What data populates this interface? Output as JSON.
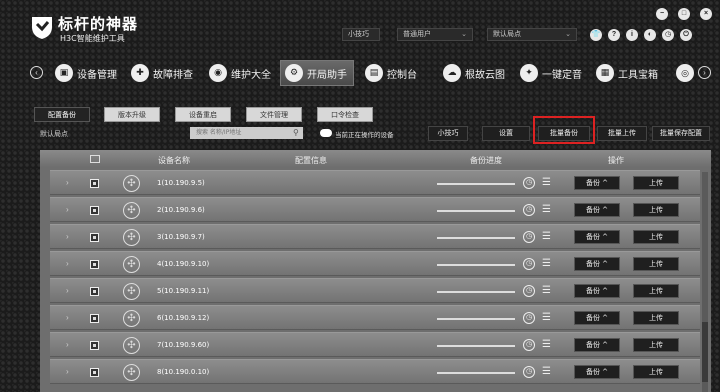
{
  "app": {
    "title": "标杆的神器",
    "subtitle": "H3C智能维护工具",
    "tips_button": "小技巧",
    "user_select": "普通用户",
    "site_select": "默认局点",
    "window_icons": [
      "shirt-icon",
      "help-icon",
      "info-icon",
      "theme-icon",
      "clock-icon",
      "power-icon"
    ]
  },
  "nav": {
    "items": [
      {
        "label": "设备管理",
        "icon": "device-icon"
      },
      {
        "label": "故障排查",
        "icon": "troubleshoot-icon"
      },
      {
        "label": "维护大全",
        "icon": "maintenance-icon"
      },
      {
        "label": "开局助手",
        "icon": "gear-icon"
      },
      {
        "label": "控制台",
        "icon": "console-icon"
      },
      {
        "label": "根故云图",
        "icon": "cloud-icon"
      },
      {
        "label": "一键定音",
        "icon": "oneclick-icon"
      },
      {
        "label": "工具宝箱",
        "icon": "toolbox-icon"
      }
    ],
    "active_index": 3
  },
  "tabs": [
    "配置备份",
    "版本升级",
    "设备重启",
    "文件管理",
    "口令检查"
  ],
  "toolbar": {
    "site_label": "默认局点",
    "search_placeholder": "搜索 名称/IP地址",
    "toggle_label": "当前正在操作的设备",
    "tips": "小技巧",
    "settings": "设置",
    "batch_backup": "批量备份",
    "batch_upload": "批量上传",
    "batch_save_config": "批量保存配置"
  },
  "grid": {
    "headers": {
      "name": "设备名称",
      "config": "配置信息",
      "progress": "备份进度",
      "actions": "操作"
    },
    "rows": [
      {
        "name": "1(10.190.9.5)",
        "progress": 0,
        "backup": "备份 ^",
        "upload": "上传"
      },
      {
        "name": "2(10.190.9.6)",
        "progress": 0,
        "backup": "备份 ^",
        "upload": "上传"
      },
      {
        "name": "3(10.190.9.7)",
        "progress": 0,
        "backup": "备份 ^",
        "upload": "上传"
      },
      {
        "name": "4(10.190.9.10)",
        "progress": 0,
        "backup": "备份 ^",
        "upload": "上传"
      },
      {
        "name": "5(10.190.9.11)",
        "progress": 0,
        "backup": "备份 ^",
        "upload": "上传"
      },
      {
        "name": "6(10.190.9.12)",
        "progress": 0,
        "backup": "备份 ^",
        "upload": "上传"
      },
      {
        "name": "7(10.190.9.60)",
        "progress": 0,
        "backup": "备份 ^",
        "upload": "上传"
      },
      {
        "name": "8(10.190.0.10)",
        "progress": 0,
        "backup": "备份 ^",
        "upload": "上传"
      }
    ]
  }
}
